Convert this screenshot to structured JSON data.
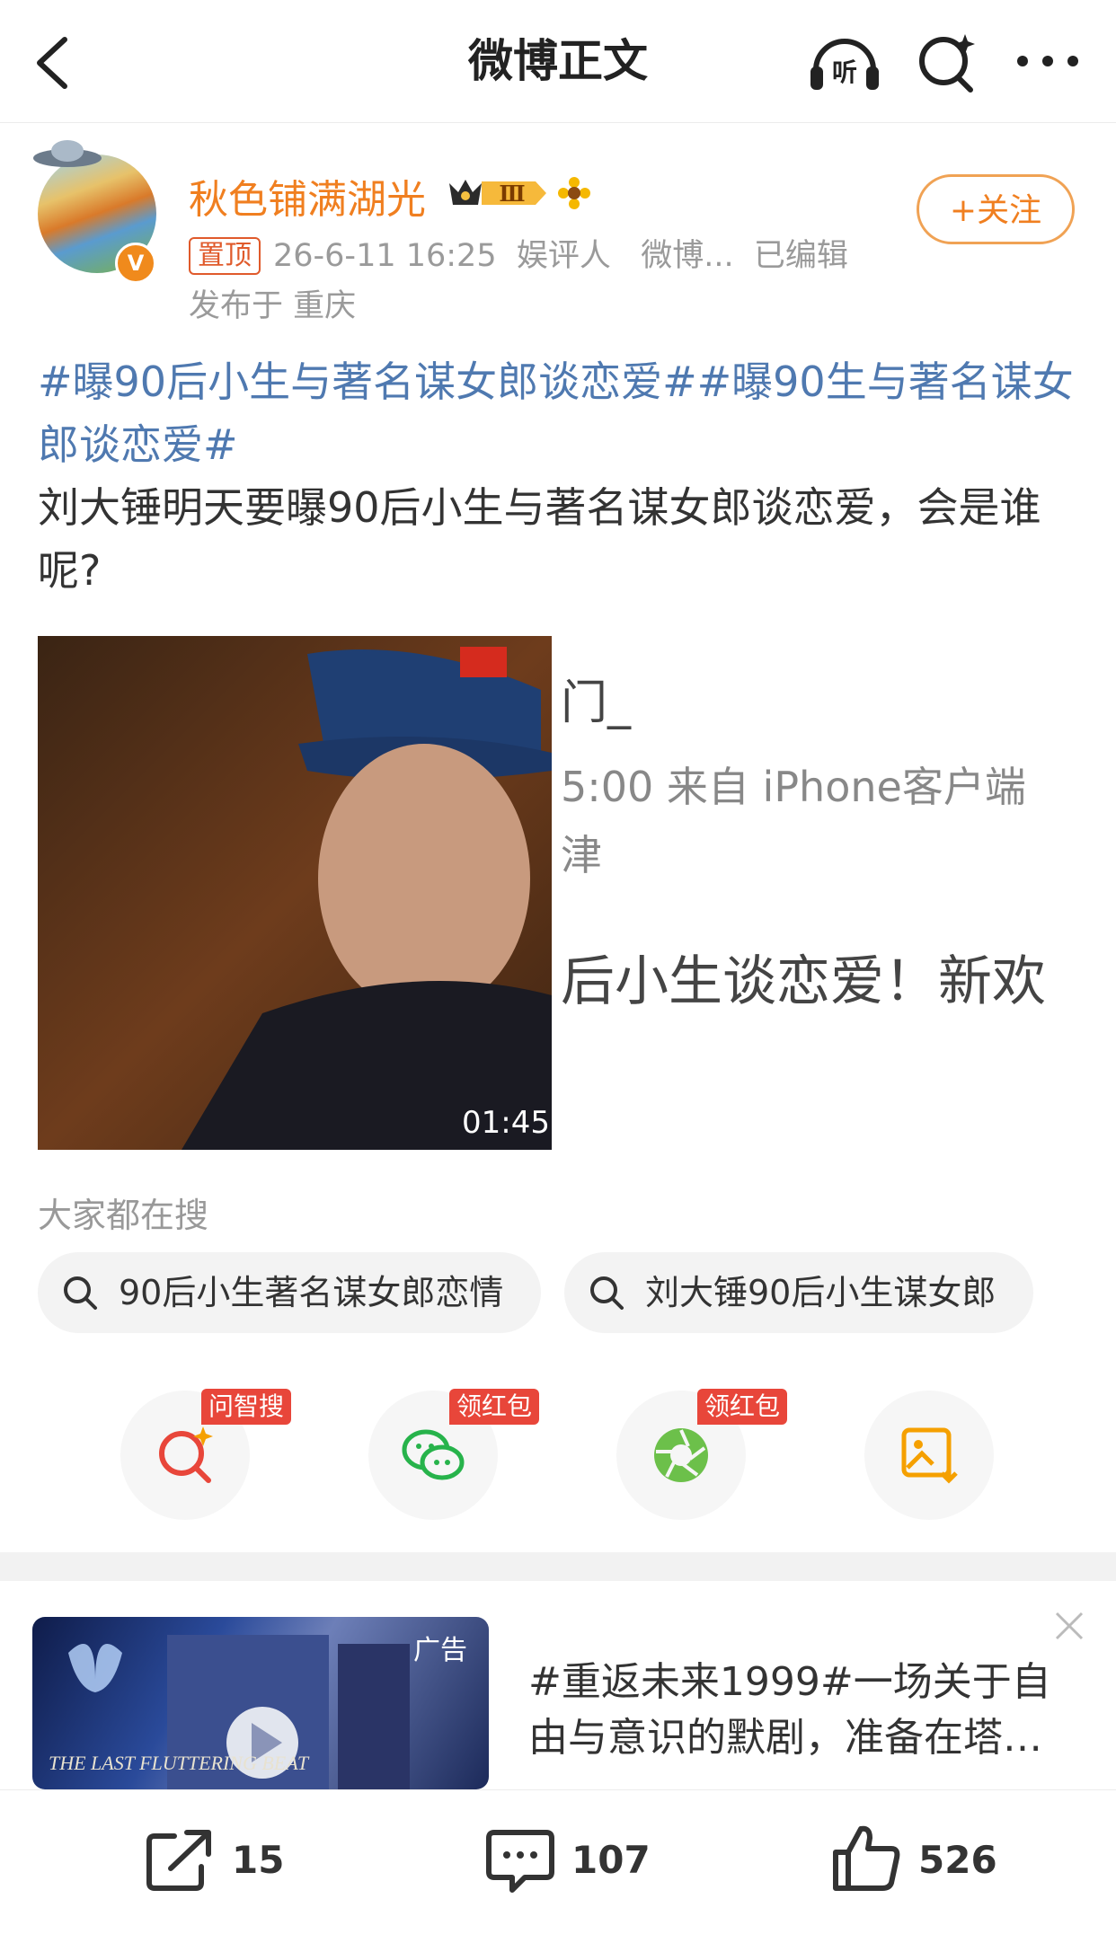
{
  "header": {
    "title": "微博正文",
    "listen_label": "听"
  },
  "author": {
    "name": "秋色铺满湖光",
    "vip_level": "Ⅲ",
    "verified_mark": "V",
    "pinned_label": "置顶",
    "timestamp": "26-6-11 16:25",
    "role": "娱评人",
    "source": "微博...",
    "edited": "已编辑",
    "location": "发布于 重庆",
    "follow_label": "+关注"
  },
  "post": {
    "hashtag1": "#曝90后小生与著名谋女郎谈恋爱#",
    "hashtag2": "#曝90生与著名谋女郎谈恋爱#",
    "text": "刘大锤明天要曝90后小生与著名谋女郎谈恋爱，会是谁呢?"
  },
  "media": {
    "video_duration": "01:45",
    "screenshot_line1": "门_",
    "screenshot_line2": "5:00  来自 iPhone客户端",
    "screenshot_line3": "津",
    "screenshot_line4": "后小生谈恋爱！新欢是"
  },
  "search": {
    "label": "大家都在搜",
    "chips": [
      "90后小生著名谋女郎恋情",
      "刘大锤90后小生谋女郎"
    ]
  },
  "share": {
    "tags": [
      "问智搜",
      "领红包",
      "领红包"
    ],
    "icons": [
      "ai-search-icon",
      "wechat-icon",
      "moments-icon",
      "save-image-icon"
    ]
  },
  "ad": {
    "label": "广告",
    "text": "#重返未来1999#一场关于自由与意识的默剧，准备在塔…",
    "image_text": "THE LAST FLUTTERING BEAT"
  },
  "actions": {
    "repost": "15",
    "comment": "107",
    "like": "526"
  },
  "colors": {
    "accent": "#f07f20",
    "link": "#4f79b0",
    "red": "#e8463a"
  }
}
